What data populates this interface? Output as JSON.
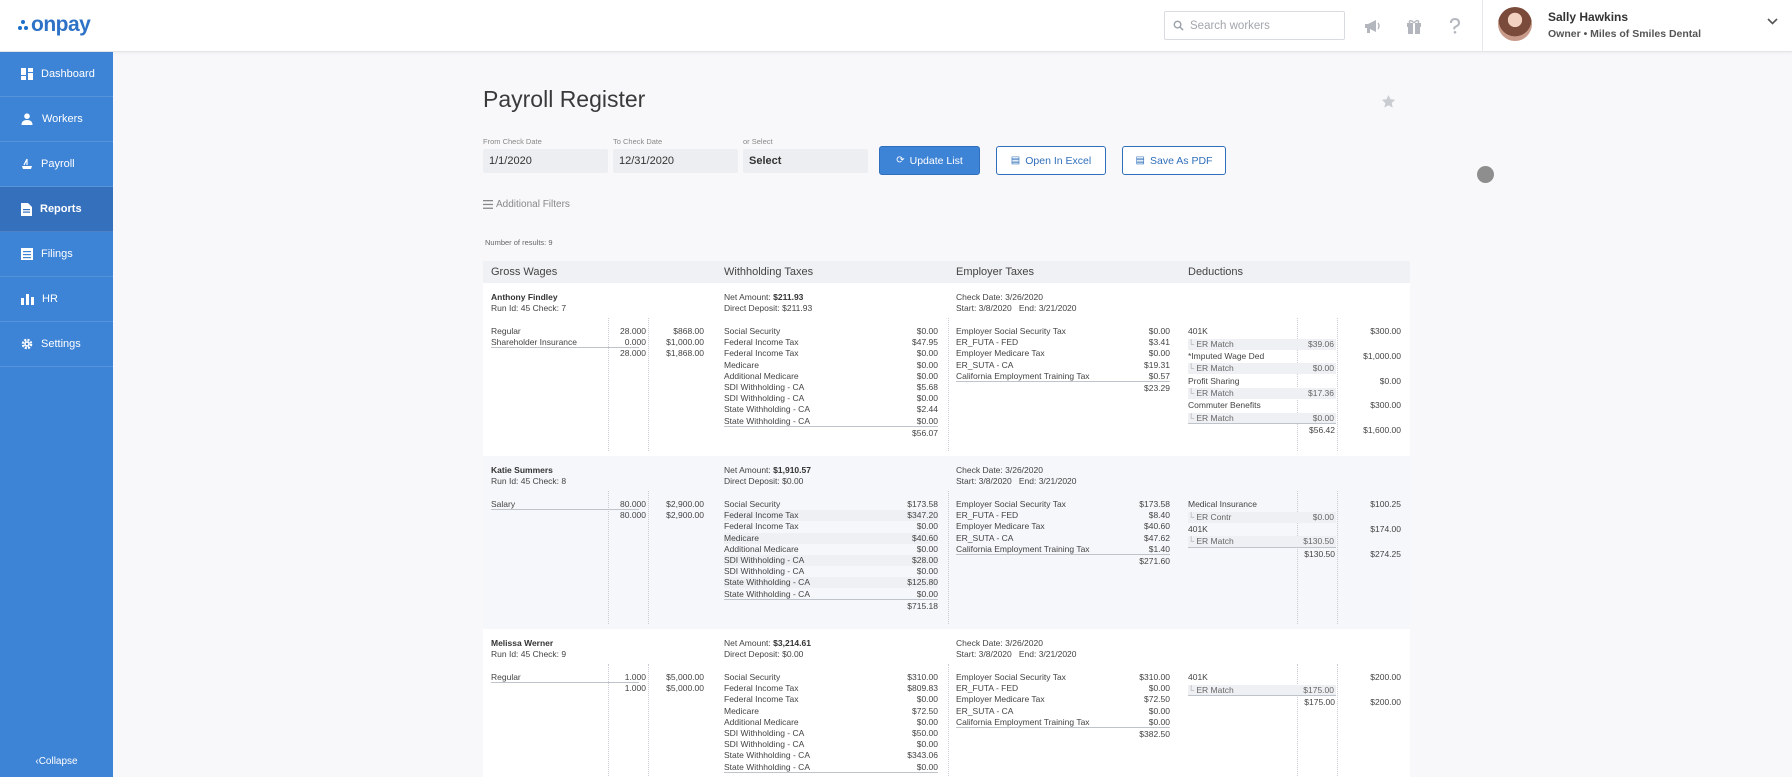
{
  "app": {
    "logo_text": "onpay"
  },
  "topbar": {
    "search_placeholder": "Search workers",
    "icons": [
      "megaphone-icon",
      "gift-icon",
      "help-icon"
    ],
    "user_name": "Sally Hawkins",
    "user_role": "Owner • Miles of Smiles Dental"
  },
  "sidebar": {
    "items": [
      {
        "label": "Dashboard",
        "icon": "dashboard-icon"
      },
      {
        "label": "Workers",
        "icon": "workers-icon"
      },
      {
        "label": "Payroll",
        "icon": "payroll-icon"
      },
      {
        "label": "Reports",
        "icon": "reports-icon",
        "active": true
      },
      {
        "label": "Filings",
        "icon": "filings-icon"
      },
      {
        "label": "HR",
        "icon": "hr-icon"
      },
      {
        "label": "Settings",
        "icon": "gear-icon"
      }
    ],
    "collapse_label": "Collapse"
  },
  "page": {
    "title": "Payroll Register",
    "from_label": "From Check Date",
    "from_value": "1/1/2020",
    "to_label": "To Check Date",
    "to_value": "12/31/2020",
    "or_label": "or Select",
    "select_value": "Select",
    "update_label": "Update List",
    "excel_label": "Open In Excel",
    "pdf_label": "Save As PDF",
    "filters_label": "Additional Filters",
    "results_label": "Number of results: 9"
  },
  "register": {
    "headers": [
      "Gross Wages",
      "Withholding Taxes",
      "Employer Taxes",
      "Deductions"
    ],
    "employees": [
      {
        "name": "Anthony Findley",
        "run": "Run Id: 45 Check: 7",
        "net_label": "Net Amount:",
        "net": "$211.93",
        "dd_label": "Direct Deposit:",
        "dd": "$211.93",
        "check_date": "Check Date: 3/26/2020",
        "period": "Start: 3/8/2020   End: 3/21/2020",
        "wages": [
          [
            "Regular",
            "28.000",
            "$868.00"
          ],
          [
            "Shareholder Insurance",
            "0.000",
            "$1,000.00"
          ]
        ],
        "wages_total": [
          "28.000",
          "$1,868.00"
        ],
        "wh": [
          [
            "Social Security",
            "$0.00"
          ],
          [
            "Federal Income Tax",
            "$47.95"
          ],
          [
            "Federal Income Tax",
            "$0.00"
          ],
          [
            "Medicare",
            "$0.00"
          ],
          [
            "Additional Medicare",
            "$0.00"
          ],
          [
            "SDI Withholding - CA",
            "$5.68"
          ],
          [
            "SDI Withholding - CA",
            "$0.00"
          ],
          [
            "State Withholding - CA",
            "$2.44"
          ],
          [
            "State Withholding - CA",
            "$0.00"
          ]
        ],
        "wh_total": "$56.07",
        "er": [
          [
            "Employer Social Security Tax",
            "$0.00"
          ],
          [
            "ER_FUTA - FED",
            "$3.41"
          ],
          [
            "Employer Medicare Tax",
            "$0.00"
          ],
          [
            "ER_SUTA - CA",
            "$19.31"
          ],
          [
            "California Employment Training Tax",
            "$0.57"
          ]
        ],
        "er_total": "$23.29",
        "ded": [
          [
            "401K",
            "",
            "$300.00",
            false
          ],
          [
            "ER Match",
            "$39.06",
            "",
            true
          ],
          [
            "*Imputed Wage Ded",
            "",
            "$1,000.00",
            false
          ],
          [
            "ER Match",
            "$0.00",
            "",
            true
          ],
          [
            "Profit Sharing",
            "",
            "$0.00",
            false
          ],
          [
            "ER Match",
            "$17.36",
            "",
            true
          ],
          [
            "Commuter Benefits",
            "",
            "$300.00",
            false
          ],
          [
            "ER Match",
            "$0.00",
            "",
            true
          ]
        ],
        "ded_total": [
          "$56.42",
          "$1,600.00"
        ]
      },
      {
        "name": "Katie Summers",
        "run": "Run Id: 45 Check: 8",
        "net_label": "Net Amount:",
        "net": "$1,910.57",
        "dd_label": "Direct Deposit:",
        "dd": "$0.00",
        "check_date": "Check Date: 3/26/2020",
        "period": "Start: 3/8/2020   End: 3/21/2020",
        "wages": [
          [
            "Salary",
            "80.000",
            "$2,900.00"
          ]
        ],
        "wages_total": [
          "80.000",
          "$2,900.00"
        ],
        "wh": [
          [
            "Social Security",
            "$173.58"
          ],
          [
            "Federal Income Tax",
            "$347.20"
          ],
          [
            "Federal Income Tax",
            "$0.00"
          ],
          [
            "Medicare",
            "$40.60"
          ],
          [
            "Additional Medicare",
            "$0.00"
          ],
          [
            "SDI Withholding - CA",
            "$28.00"
          ],
          [
            "SDI Withholding - CA",
            "$0.00"
          ],
          [
            "State Withholding - CA",
            "$125.80"
          ],
          [
            "State Withholding - CA",
            "$0.00"
          ]
        ],
        "wh_total": "$715.18",
        "er": [
          [
            "Employer Social Security Tax",
            "$173.58"
          ],
          [
            "ER_FUTA - FED",
            "$8.40"
          ],
          [
            "Employer Medicare Tax",
            "$40.60"
          ],
          [
            "ER_SUTA - CA",
            "$47.62"
          ],
          [
            "California Employment Training Tax",
            "$1.40"
          ]
        ],
        "er_total": "$271.60",
        "ded": [
          [
            "Medical Insurance",
            "",
            "$100.25",
            false
          ],
          [
            "ER Contr",
            "$0.00",
            "",
            true
          ],
          [
            "401K",
            "",
            "$174.00",
            false
          ],
          [
            "ER Match",
            "$130.50",
            "",
            true
          ]
        ],
        "ded_total": [
          "$130.50",
          "$274.25"
        ]
      },
      {
        "name": "Melissa Werner",
        "run": "Run Id: 45 Check: 9",
        "net_label": "Net Amount:",
        "net": "$3,214.61",
        "dd_label": "Direct Deposit:",
        "dd": "$0.00",
        "check_date": "Check Date: 3/26/2020",
        "period": "Start: 3/8/2020   End: 3/21/2020",
        "wages": [
          [
            "Regular",
            "1.000",
            "$5,000.00"
          ]
        ],
        "wages_total": [
          "1.000",
          "$5,000.00"
        ],
        "wh": [
          [
            "Social Security",
            "$310.00"
          ],
          [
            "Federal Income Tax",
            "$809.83"
          ],
          [
            "Federal Income Tax",
            "$0.00"
          ],
          [
            "Medicare",
            "$72.50"
          ],
          [
            "Additional Medicare",
            "$0.00"
          ],
          [
            "SDI Withholding - CA",
            "$50.00"
          ],
          [
            "SDI Withholding - CA",
            "$0.00"
          ],
          [
            "State Withholding - CA",
            "$343.06"
          ],
          [
            "State Withholding - CA",
            "$0.00"
          ]
        ],
        "wh_total": "",
        "er": [
          [
            "Employer Social Security Tax",
            "$310.00"
          ],
          [
            "ER_FUTA - FED",
            "$0.00"
          ],
          [
            "Employer Medicare Tax",
            "$72.50"
          ],
          [
            "ER_SUTA - CA",
            "$0.00"
          ],
          [
            "California Employment Training Tax",
            "$0.00"
          ]
        ],
        "er_total": "$382.50",
        "ded": [
          [
            "401K",
            "",
            "$200.00",
            false
          ],
          [
            "ER Match",
            "$175.00",
            "",
            true
          ]
        ],
        "ded_total": [
          "$175.00",
          "$200.00"
        ]
      }
    ]
  }
}
